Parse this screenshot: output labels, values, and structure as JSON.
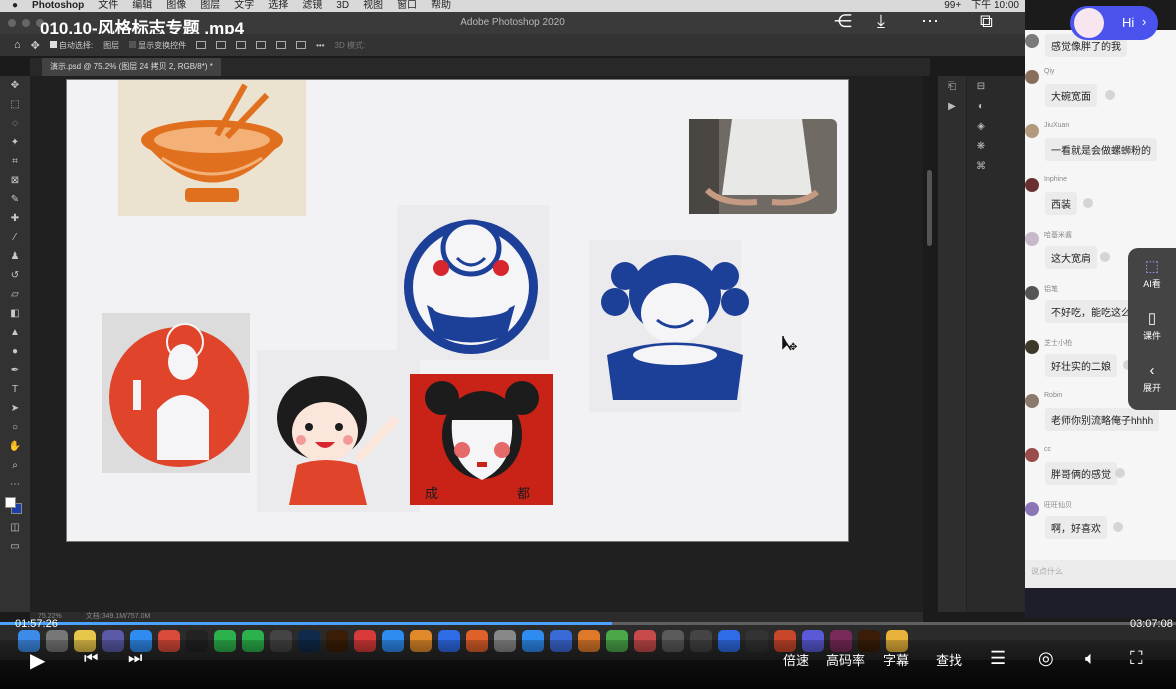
{
  "mac_menu": {
    "app": "Photoshop",
    "items": [
      "文件",
      "编辑",
      "图像",
      "图层",
      "文字",
      "选择",
      "滤镜",
      "3D",
      "视图",
      "窗口",
      "帮助"
    ],
    "status_right": [
      "99+",
      "下午 10:00"
    ]
  },
  "video": {
    "title": "010.10-风格标志专题 .mp4",
    "time_current": "01:57:26",
    "time_total": "03:07:08",
    "progress": 0.52,
    "controls": {
      "speed": "倍速",
      "bitrate": "高码率",
      "subtitles": "字幕",
      "search": "查找"
    }
  },
  "photoshop": {
    "window_title": "Adobe Photoshop 2020",
    "options": {
      "auto_select": "自动选择:",
      "layer": "图层",
      "show_transform": "显示变换控件",
      "mode3d": "3D 模式:"
    },
    "doc_tab": "演示.psd @ 75.2% (图层 24 拷贝 2, RGB/8*) *",
    "status": {
      "zoom": "75.22%",
      "doc": "文档:349.1M/757.0M"
    },
    "colors": {
      "foreground": "#ffffff",
      "background": "#1a3ea8"
    },
    "tools": [
      "move-icon",
      "marquee-icon",
      "lasso-icon",
      "magic-wand-icon",
      "crop-icon",
      "frame-icon",
      "eyedropper-icon",
      "healing-icon",
      "brush-icon",
      "stamp-icon",
      "history-brush-icon",
      "eraser-icon",
      "gradient-icon",
      "blur-icon",
      "dodge-icon",
      "pen-icon",
      "type-icon",
      "path-select-icon",
      "shape-icon",
      "hand-icon",
      "zoom-icon",
      "more-icon"
    ]
  },
  "chat": {
    "messages": [
      {
        "name": "",
        "text": "感觉像胖了的我"
      },
      {
        "name": "Qiy",
        "text": "大碗宽面"
      },
      {
        "name": "JiuXuan",
        "text": "一看就是会做螺蛳粉的"
      },
      {
        "name": "Inphine",
        "text": "西装"
      },
      {
        "name": "哈基米酱",
        "text": "这大宽肩"
      },
      {
        "name": "铝笔",
        "text": "不好吃，能吃这么胖"
      },
      {
        "name": "芝士小柏",
        "text": "好壮实的二娘"
      },
      {
        "name": "Robin",
        "text": "老师你别流略俺子hhhh"
      },
      {
        "name": "cc",
        "text": "胖哥俩的感觉"
      },
      {
        "name": "旺旺仙贝",
        "text": "啊，好喜欢"
      }
    ],
    "input_placeholder": "说点什么"
  },
  "side_panel": {
    "ai": "AI看",
    "courseware": "课件",
    "expand": "展开"
  },
  "overlay": {
    "hi": "Hi"
  },
  "canvas_text": {
    "seal_left": "成",
    "seal_right": "都"
  }
}
